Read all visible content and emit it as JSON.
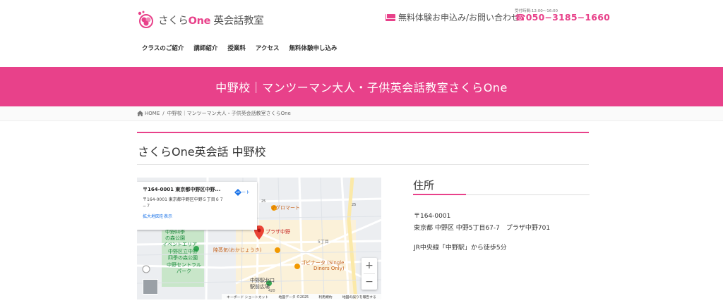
{
  "header": {
    "logo_text": "さくら",
    "logo_one": "One",
    "logo_suffix": " 英会話教室",
    "contact_label": "無料体験お申込み/お問い合わせ",
    "hours": "受付時間:12:00〜16:00",
    "phone": "☎050−3185−1660"
  },
  "nav": {
    "items": [
      "クラスのご紹介",
      "講師紹介",
      "授業料",
      "アクセス",
      "無料体験申し込み"
    ]
  },
  "banner": {
    "title": "中野校｜マンツーマン大人・子供英会話教室さくらOne"
  },
  "breadcrumb": {
    "home": "HOME",
    "sep": "/",
    "current": "中野校｜マンツーマン大人・子供英会話教室さくらOne"
  },
  "page": {
    "title": "さくらOne英会話 中野校"
  },
  "map": {
    "card_title": "〒164-0001 東京都中野区中野...",
    "card_address": "〒164-0001 東京都中野区中野５丁目６７−７",
    "enlarge_link": "拡大地図を表示",
    "route_label": "ルート",
    "zoom_in": "+",
    "zoom_out": "−",
    "labels": {
      "magnet": "マグロマート",
      "plaza": "プラザ中野",
      "kaisen": "陸蒸気(おかじょうき)",
      "godinata": "ゴビナータ (Single",
      "godinata2": "Diners Only)",
      "park1": "中野四季",
      "park2": "の森公園",
      "park3": "イベントエリア",
      "park4": "中野区立中野",
      "park5": "四季の森公園",
      "park6": "中野セントラル",
      "park7": "パーク",
      "station": "中野駅北口",
      "station2": "駅前広場",
      "chome": "5丁目",
      "road25": "25",
      "road25b": "25",
      "road420": "420"
    },
    "footer": [
      "キーボード ショートカット",
      "地図データ ©2025",
      "利用規約",
      "地図の誤りを報告する"
    ]
  },
  "address": {
    "heading": "住所",
    "postal": "〒164-0001",
    "line": "東京都 中野区 中野5丁目67-7　プラザ中野701",
    "access": "JR中央線「中野駅」から徒歩5分"
  },
  "colors": {
    "accent": "#e8418a"
  }
}
